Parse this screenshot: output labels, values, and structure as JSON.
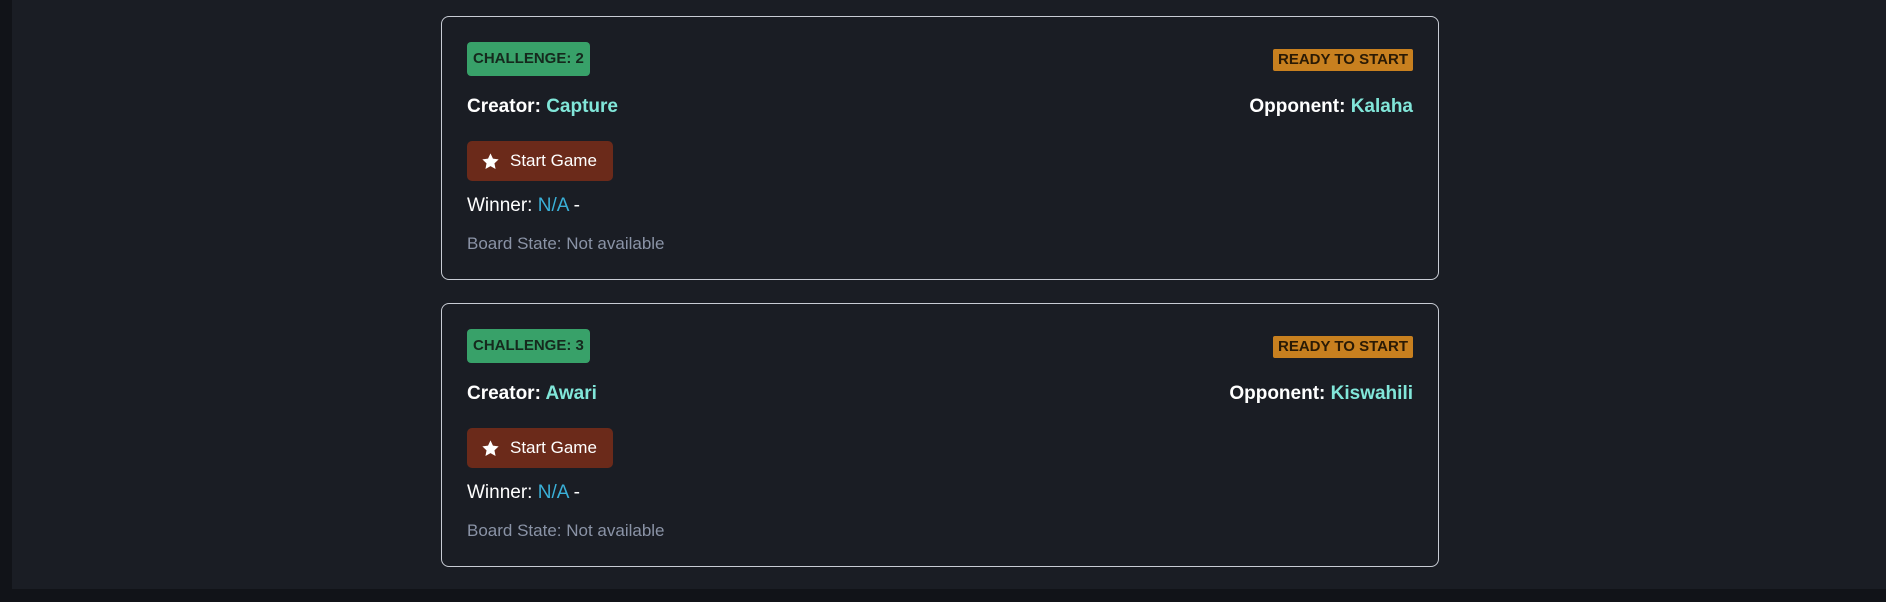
{
  "challenges": [
    {
      "id_label": "CHALLENGE: 2",
      "status": "READY TO START",
      "creator_label": "Creator:",
      "creator_name": "Capture",
      "opponent_label": "Opponent:",
      "opponent_name": "Kalaha",
      "start_label": "Start Game",
      "winner_label": "Winner:",
      "winner_value": "N/A",
      "winner_suffix": "-",
      "board_state": "Board State: Not available"
    },
    {
      "id_label": "CHALLENGE: 3",
      "status": "READY TO START",
      "creator_label": "Creator:",
      "creator_name": "Awari",
      "opponent_label": "Opponent:",
      "opponent_name": "Kiswahili",
      "start_label": "Start Game",
      "winner_label": "Winner:",
      "winner_value": "N/A",
      "winner_suffix": "-",
      "board_state": "Board State: Not available"
    }
  ],
  "colors": {
    "background": "#1a1d24",
    "badge_id": "#38a169",
    "badge_status": "#c8801f",
    "name_accent": "#81e6d9",
    "winner_accent": "#3ab0d8",
    "start_button": "#6b2a1a"
  },
  "icons": {
    "start_button_icon": "star-icon"
  }
}
